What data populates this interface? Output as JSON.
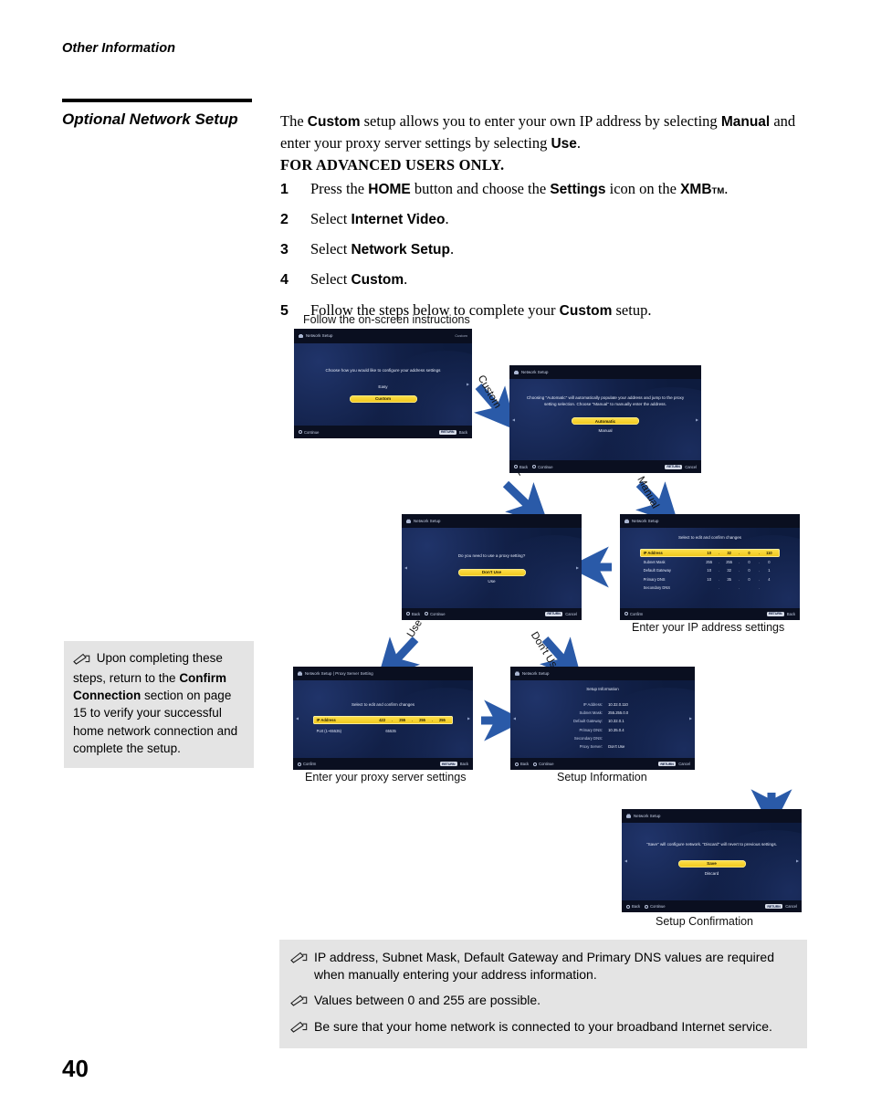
{
  "running_head": "Other Information",
  "section": {
    "title": "Optional Network Setup"
  },
  "page_number": "40",
  "intro": {
    "l1_a": "The ",
    "l1_b": "Custom",
    "l1_c": " setup allows you to enter your own IP address by selecting",
    "l2_a": "Manual",
    "l2_b": " and enter your proxy server settings by selecting ",
    "l2_c": "Use",
    "l2_d": ".",
    "l3": "FOR ADVANCED USERS ONLY."
  },
  "steps": [
    {
      "num": "1",
      "pre": "Press the ",
      "b1": "HOME",
      "mid": " button and choose the ",
      "b2": "Settings",
      "mid2": " icon on the ",
      "b3": "XMB",
      "tm": "TM",
      "post": "."
    },
    {
      "num": "2",
      "pre": "Select ",
      "b1": "Internet Video",
      "post": "."
    },
    {
      "num": "3",
      "pre": "Select ",
      "b1": "Network Setup",
      "post": "."
    },
    {
      "num": "4",
      "pre": "Select ",
      "b1": "Custom",
      "post": "."
    },
    {
      "num": "5",
      "pre": "Follow the steps below to complete your ",
      "b1": "Custom",
      "post": " setup."
    }
  ],
  "sidenote": {
    "icon": "note-pen-icon",
    "a": " Upon completing these steps, return to the ",
    "b": "Confirm Connection",
    "c": " section on page 15 to verify your successful home network connection and complete the setup."
  },
  "bottom_notes": [
    {
      "icon": "note-pen-icon",
      "text": "IP address, Subnet Mask, Default Gateway and Primary DNS values are required when manually entering your address information."
    },
    {
      "icon": "note-pen-icon",
      "text": "Values between 0 and 255 are possible."
    },
    {
      "icon": "note-pen-icon",
      "text": "Be sure that your home network is connected to your broadband Internet service."
    }
  ],
  "flow": {
    "top_caption": "Follow the on-screen instructions",
    "arrow_labels": {
      "custom": "Custom",
      "automatic": "Automatic",
      "manual": "Manual",
      "use": "Use",
      "dont_use": "Don't Use"
    },
    "captions": {
      "ip_settings": "Enter your IP address settings",
      "proxy_settings": "Enter your proxy server settings",
      "setup_information": "Setup Information",
      "setup_confirmation": "Setup Confirmation"
    },
    "arrow_color": "#2a5aa8"
  },
  "screens": {
    "configure": {
      "title": "Network Setup",
      "top_right": "Custom",
      "prompt": "Choose how you would like to configure your address settings",
      "options": [
        "Easy",
        "Custom"
      ],
      "selected": "Custom",
      "footer_left": "Continue",
      "footer_right_key": "RETURN",
      "footer_right": "Back"
    },
    "auto_manual": {
      "title": "Network Setup",
      "prompt": "Choosing \"Automatic\" will automatically populate your address and jump to the proxy setting selection. Choose \"Manual\" to manually enter the address.",
      "options": [
        "Automatic",
        "Manual"
      ],
      "selected": "Automatic",
      "footer_left": "Back",
      "footer_left2": "Continue",
      "footer_right_key": "RETURN",
      "footer_right": "Cancel"
    },
    "proxy_question": {
      "title": "Network Setup",
      "prompt": "Do you need to use a proxy setting?",
      "options": [
        "Don't Use",
        "Use"
      ],
      "selected": "Don't Use",
      "footer_left": "Back",
      "footer_left2": "Continue",
      "footer_right_key": "RETURN",
      "footer_right": "Cancel"
    },
    "ip_settings": {
      "title": "Network Setup",
      "heading": "Select to edit and confirm changes",
      "rows": [
        {
          "label": "IP Address",
          "octets": [
            "10",
            "32",
            "0",
            "110"
          ],
          "selected": true
        },
        {
          "label": "Subnet Mask",
          "octets": [
            "255",
            "255",
            "0",
            "0"
          ],
          "selected": false
        },
        {
          "label": "Default Gateway",
          "octets": [
            "10",
            "32",
            "0",
            "1"
          ],
          "selected": false
        },
        {
          "label": "Primary DNS",
          "octets": [
            "10",
            "35",
            "0",
            "4"
          ],
          "selected": false
        },
        {
          "label": "Secondary DNS",
          "octets": [
            "",
            "",
            "",
            ""
          ],
          "selected": false
        }
      ],
      "footer_left": "Confirm",
      "footer_right_key": "RETURN",
      "footer_right": "Back"
    },
    "proxy_settings": {
      "title": "Network Setup | Proxy Server Setting",
      "heading": "Select to edit and confirm changes",
      "rows": [
        {
          "label": "IP Address",
          "octets": [
            "422",
            "255",
            "255",
            "255"
          ],
          "selected": true
        }
      ],
      "port_label": "Port (1~65535)",
      "port_value": "65535",
      "footer_left": "Confirm",
      "footer_right_key": "RETURN",
      "footer_right": "Back"
    },
    "setup_information": {
      "title": "Network Setup",
      "heading": "Setup Information",
      "rows": [
        {
          "k": "IP Address:",
          "v": "10.32.0.110"
        },
        {
          "k": "Subnet Mask:",
          "v": "255.255.0.0"
        },
        {
          "k": "Default Gateway:",
          "v": "10.32.0.1"
        },
        {
          "k": "Primary DNS:",
          "v": "10.35.0.4"
        },
        {
          "k": "Secondary DNS:",
          "v": ""
        },
        {
          "k": "Proxy Server:",
          "v": "Don't Use"
        }
      ],
      "footer_left": "Back",
      "footer_left2": "Continue",
      "footer_right_key": "RETURN",
      "footer_right": "Cancel"
    },
    "setup_confirmation": {
      "title": "Network Setup",
      "prompt": "\"Save\" will configure network. \"Discard\" will revert to previous settings.",
      "options": [
        "Save",
        "Discard"
      ],
      "selected": "Save",
      "footer_left": "Back",
      "footer_left2": "Continue",
      "footer_right_key": "RETURN",
      "footer_right": "Cancel"
    }
  }
}
